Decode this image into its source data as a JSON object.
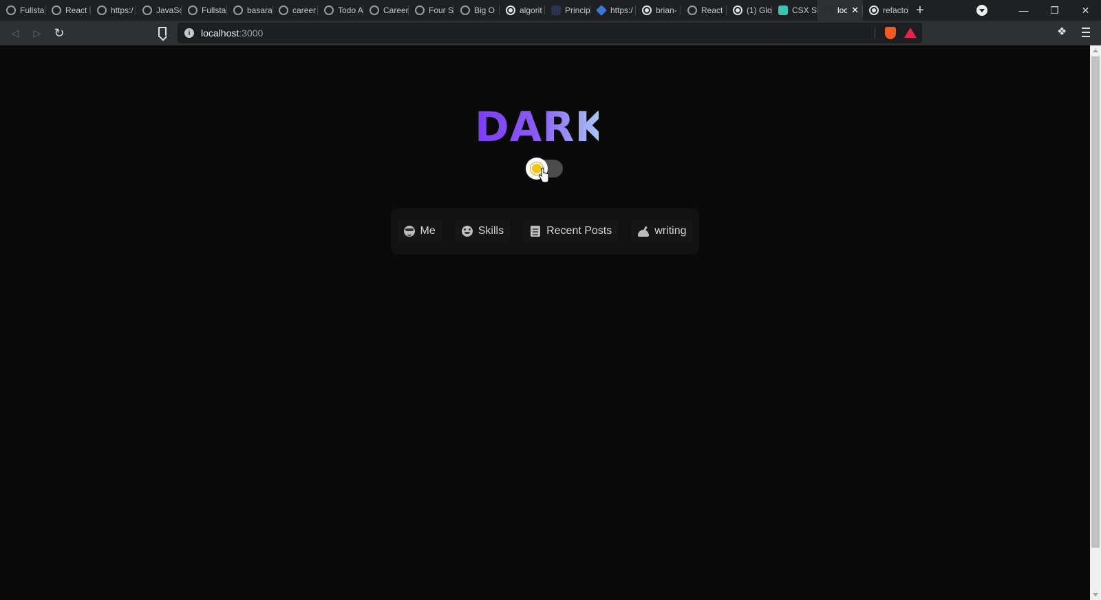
{
  "tabs": [
    {
      "label": "Fullsta",
      "icon": "globe-icon"
    },
    {
      "label": "React I",
      "icon": "globe-icon"
    },
    {
      "label": "https:/",
      "icon": "globe-icon"
    },
    {
      "label": "JavaSc",
      "icon": "globe-icon"
    },
    {
      "label": "Fullsta",
      "icon": "globe-icon"
    },
    {
      "label": "basara",
      "icon": "globe-icon"
    },
    {
      "label": "career",
      "icon": "globe-icon"
    },
    {
      "label": "Todo A",
      "icon": "globe-icon"
    },
    {
      "label": "Career",
      "icon": "globe-icon"
    },
    {
      "label": "Four S",
      "icon": "globe-icon"
    },
    {
      "label": "Big O",
      "icon": "globe-icon"
    },
    {
      "label": "algorit",
      "icon": "github-icon"
    },
    {
      "label": "Princip",
      "icon": "blank-icon"
    },
    {
      "label": "https:/",
      "icon": "diamond-icon"
    },
    {
      "label": "brian-",
      "icon": "github-icon"
    },
    {
      "label": "React",
      "icon": "globe-icon"
    },
    {
      "label": "(1) Glo",
      "icon": "github-icon"
    },
    {
      "label": "CSX St",
      "icon": "csx-icon"
    },
    {
      "label": "loc",
      "icon": "page-icon",
      "active": true
    },
    {
      "label": "refacto",
      "icon": "github-icon"
    }
  ],
  "address_bar": {
    "host": "localhost",
    "port": ":3000"
  },
  "page": {
    "heading": "DARK",
    "theme_toggle": {
      "state": "dark",
      "icon": "sun-icon"
    },
    "nav": [
      {
        "label": "Me",
        "icon": "sunglasses-face-icon"
      },
      {
        "label": "Skills",
        "icon": "star-eyes-face-icon"
      },
      {
        "label": "Recent Posts",
        "icon": "newspaper-icon"
      },
      {
        "label": "writing",
        "icon": "writing-hand-icon"
      }
    ]
  },
  "colors": {
    "heading_gradient_start": "#7b3cf0",
    "heading_gradient_end": "#a8c4f4",
    "page_bg": "#0a0a0a"
  }
}
